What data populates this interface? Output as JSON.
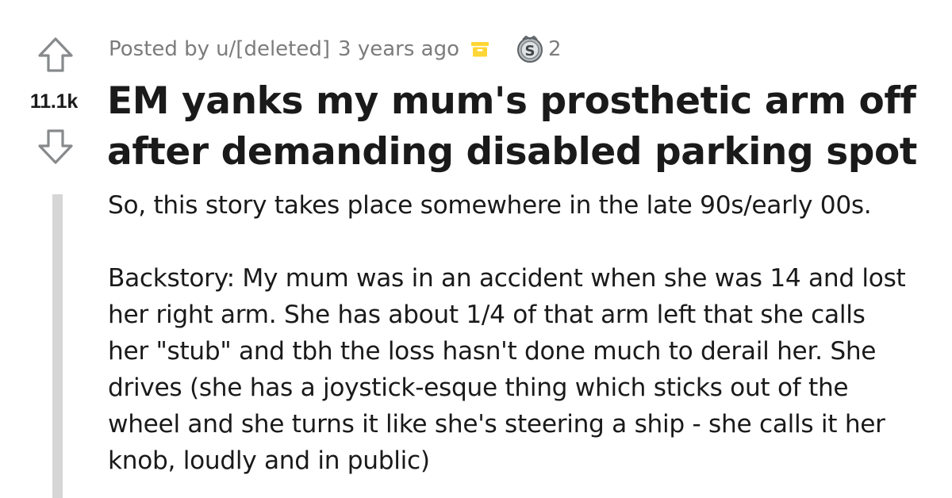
{
  "post": {
    "meta": {
      "posted_by": "Posted by",
      "user": "u/[deleted]",
      "time": "3 years ago",
      "archive_icon": "archive-box-icon",
      "award_icon": "silver-award-icon",
      "award_count": "2"
    },
    "votes": {
      "score": "11.1k",
      "upvote_icon": "upvote-arrow-icon",
      "downvote_icon": "downvote-arrow-icon"
    },
    "title": "EM yanks my mum's prosthetic arm off after demanding disabled parking spot",
    "body": {
      "paragraphs": [
        "So, this story takes place somewhere in the late 90s/early 00s.",
        "Backstory: My mum was in an accident when she was 14 and lost her right arm. She has about 1/4 of that arm left that she calls her \"stub\" and tbh the loss hasn't done much to derail her. She drives (she has a joystick-esque thing which sticks out of the wheel and she turns it like she's steering a ship - she calls it her knob, loudly and in public)"
      ]
    }
  },
  "colors": {
    "text": "#1a1a1b",
    "meta_text": "#7c7c7c",
    "arrow_stroke": "#878a8c",
    "thread_line": "#d6d6d6",
    "archive_yellow": "#ffd635"
  }
}
